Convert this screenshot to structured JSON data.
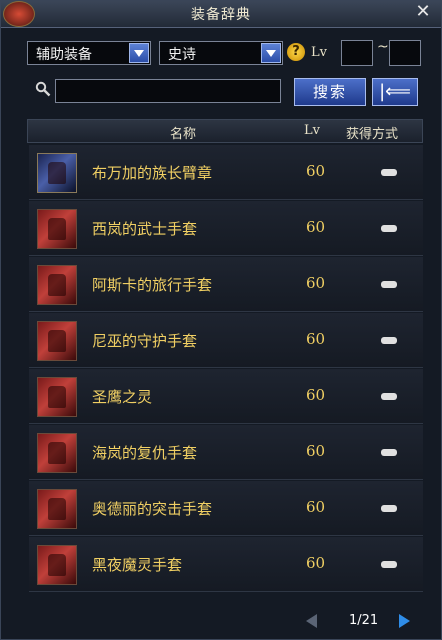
{
  "window": {
    "title": "装备辞典"
  },
  "filters": {
    "type_value": "辅助装备",
    "rarity_value": "史诗",
    "lv_label": "Lv",
    "lv_separator": "~"
  },
  "search": {
    "button_label": "搜索",
    "back_label": "|⟸"
  },
  "table": {
    "col_name": "名称",
    "col_lv": "Lv",
    "col_obtain": "获得方式",
    "rows": [
      {
        "name": "布万加的族长臂章",
        "lv": "60",
        "icon": "armband-icon"
      },
      {
        "name": "西岚的武士手套",
        "lv": "60",
        "icon": "glove-icon"
      },
      {
        "name": "阿斯卡的旅行手套",
        "lv": "60",
        "icon": "glove-icon"
      },
      {
        "name": "尼巫的守护手套",
        "lv": "60",
        "icon": "glove-icon"
      },
      {
        "name": "圣鹰之灵",
        "lv": "60",
        "icon": "glove-icon"
      },
      {
        "name": "海岚的复仇手套",
        "lv": "60",
        "icon": "glove-icon"
      },
      {
        "name": "奥德丽的突击手套",
        "lv": "60",
        "icon": "glove-icon"
      },
      {
        "name": "黑夜魔灵手套",
        "lv": "60",
        "icon": "glove-icon"
      }
    ]
  },
  "pager": {
    "text": "1/21"
  },
  "colors": {
    "accent": "#2f8de8",
    "item_text": "#f0cf63"
  }
}
